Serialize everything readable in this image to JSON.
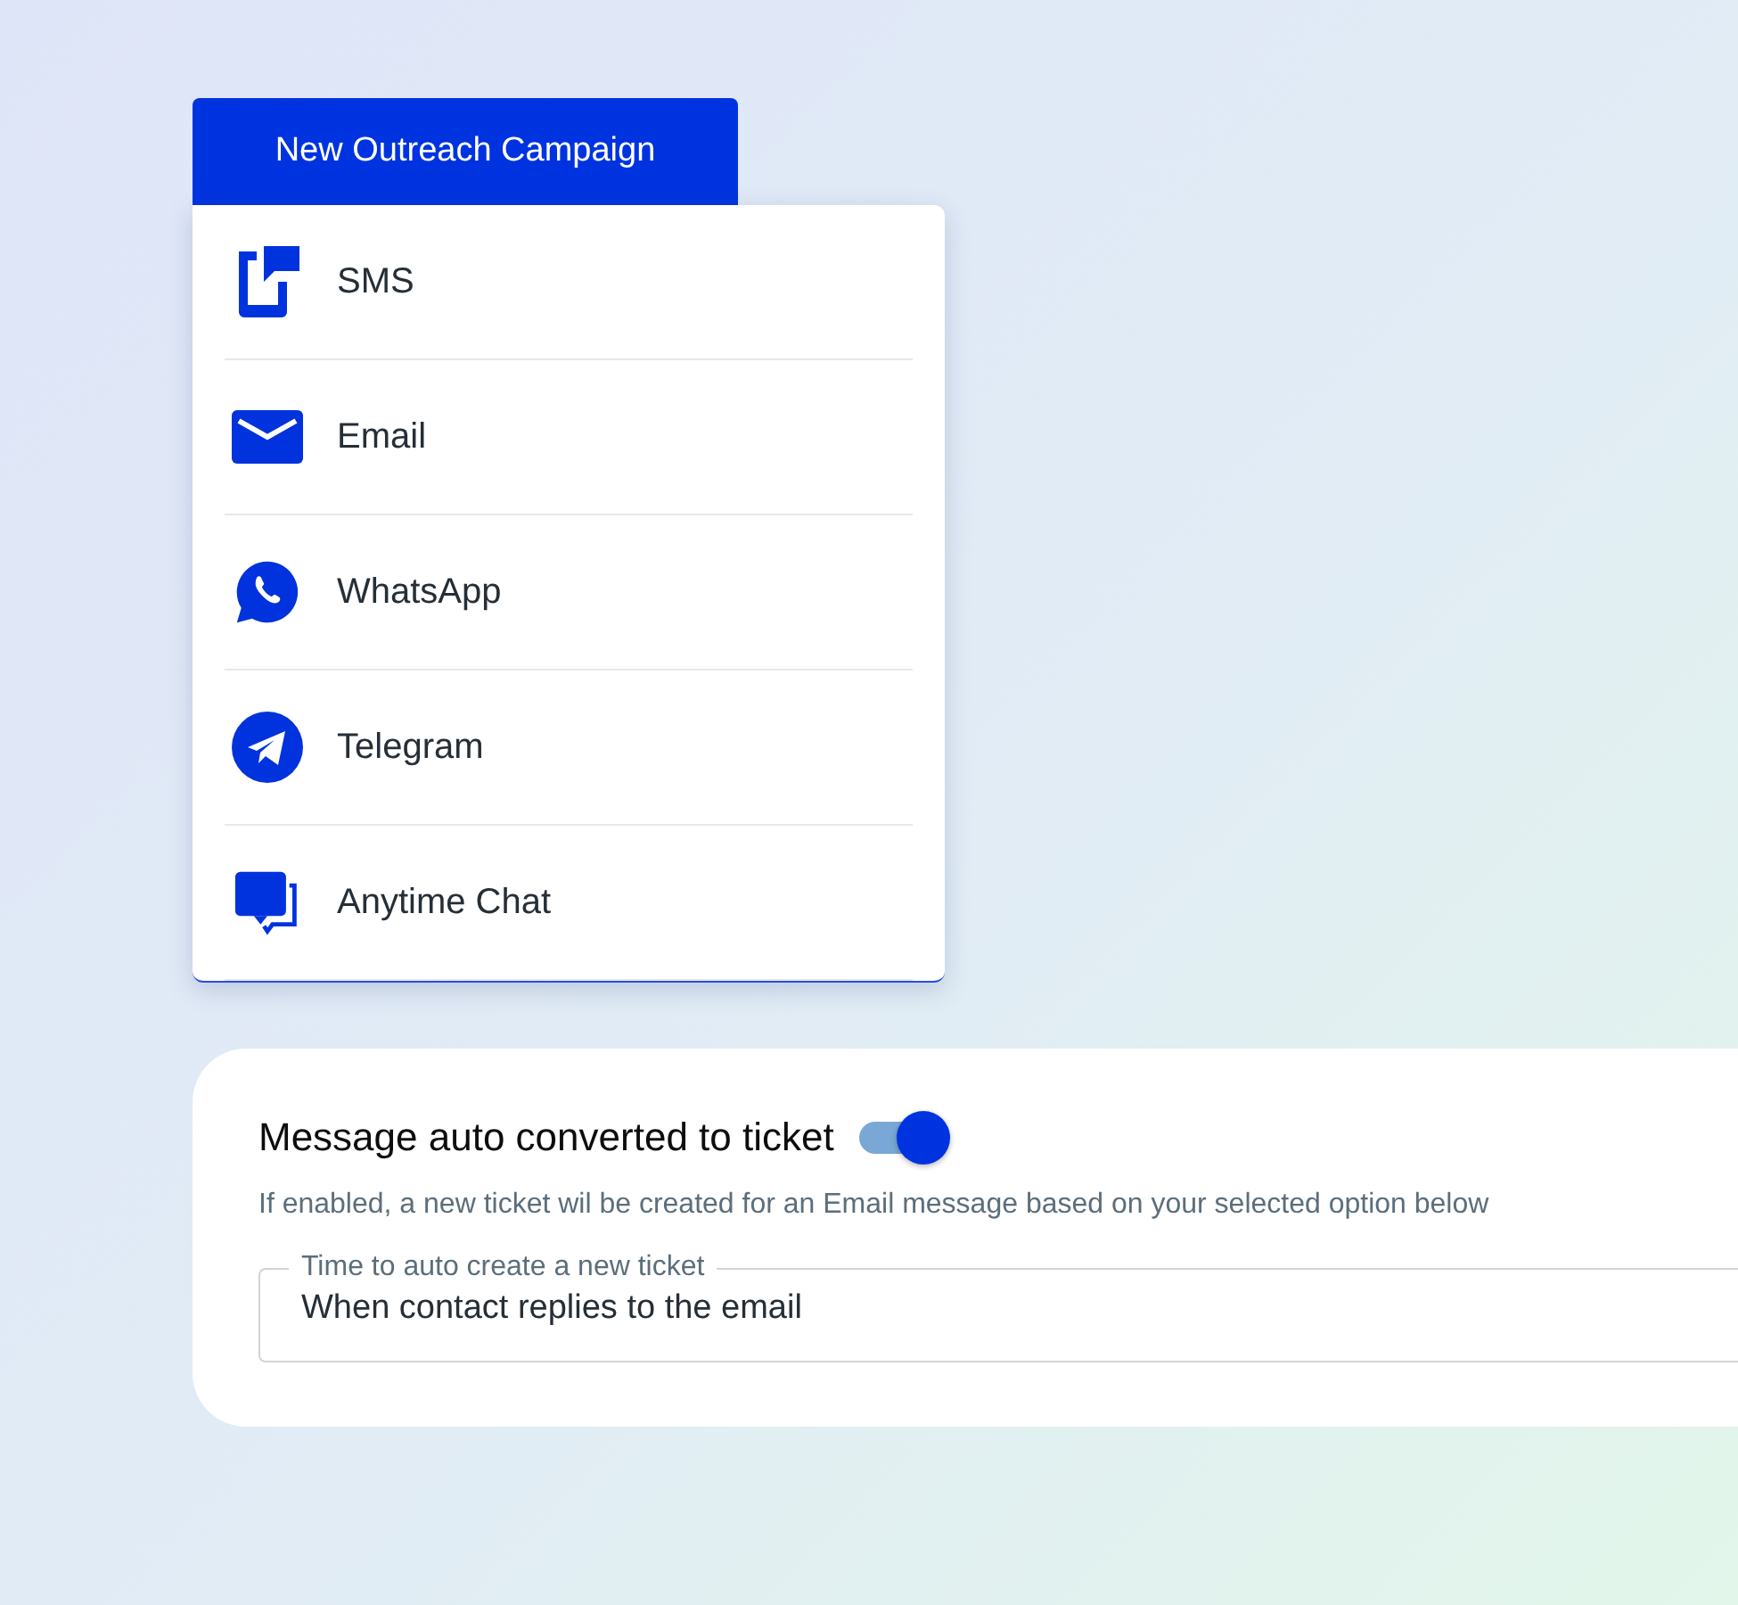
{
  "campaign_button": {
    "label": "New Outreach Campaign"
  },
  "menu": {
    "items": [
      {
        "label": "SMS",
        "kind": "sms"
      },
      {
        "label": "Email",
        "kind": "email"
      },
      {
        "label": "WhatsApp",
        "kind": "whatsapp"
      },
      {
        "label": "Telegram",
        "kind": "telegram"
      },
      {
        "label": "Anytime Chat",
        "kind": "chat"
      }
    ]
  },
  "settings_card": {
    "title": "Message auto converted to ticket",
    "toggle": {
      "on": true
    },
    "description": "If enabled, a new ticket wil be created for an Email message based on your selected option below",
    "field": {
      "label": "Time to auto create a new ticket",
      "value": "When contact replies to the email"
    }
  }
}
